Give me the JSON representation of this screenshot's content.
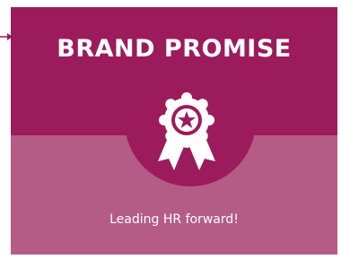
{
  "card": {
    "title": "BRAND PROMISE",
    "tagline": "Leading HR forward!",
    "icon": "award-ribbon-star-icon"
  },
  "connector": {
    "icon": "arrow-right-icon"
  },
  "colors": {
    "header_background": "#9c1b5c",
    "body_background": "#b45b86",
    "text": "#ffffff",
    "connector": "#9c1b5c"
  }
}
